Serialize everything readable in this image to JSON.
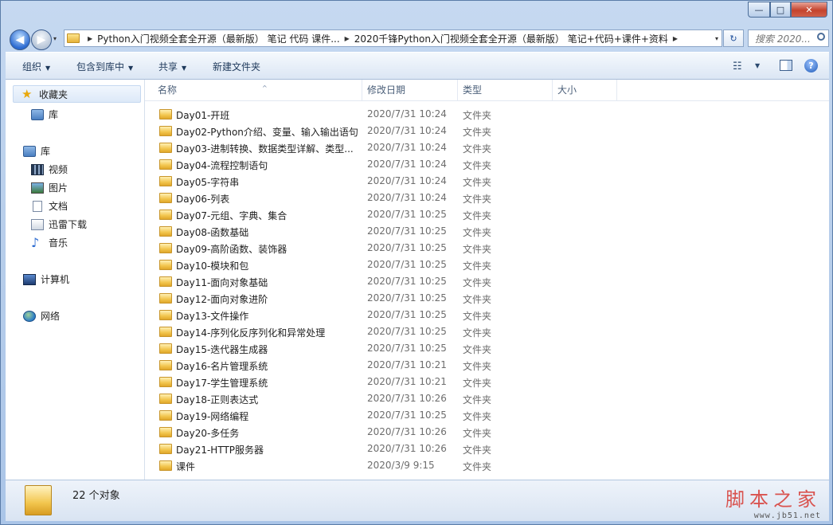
{
  "window": {
    "caption_buttons": {
      "minimize": "—",
      "maximize": "□",
      "close": "✕"
    }
  },
  "nav": {
    "back_icon": "◀",
    "forward_icon": "▶",
    "dropdown_icon": "▾"
  },
  "address": {
    "crumbs": [
      "Python入门视频全套全开源（最新版） 笔记 代码 课件...",
      "2020千锋Python入门视频全套全开源（最新版） 笔记+代码+课件+资料"
    ],
    "separator": "▶",
    "refresh_icon": "↻"
  },
  "search": {
    "placeholder": "搜索 2020..."
  },
  "toolbar": {
    "organize": "组织",
    "include_in_library": "包含到库中",
    "share": "共享",
    "new_folder": "新建文件夹",
    "dropdown_arrow": "▼",
    "view_icon": "☷",
    "help": "?"
  },
  "sidebar": {
    "favorites": "收藏夹",
    "favorites_child": "库",
    "libraries": "库",
    "lib_items": [
      "视频",
      "图片",
      "文档",
      "迅雷下载",
      "音乐"
    ],
    "computer": "计算机",
    "network": "网络"
  },
  "columns": {
    "name": "名称",
    "modified": "修改日期",
    "type": "类型",
    "size": "大小",
    "sort_arrow": "^"
  },
  "files": [
    {
      "name": "Day01-开班",
      "date": "2020/7/31 10:24",
      "type": "文件夹"
    },
    {
      "name": "Day02-Python介绍、变量、输入输出语句",
      "date": "2020/7/31 10:24",
      "type": "文件夹"
    },
    {
      "name": "Day03-进制转换、数据类型详解、类型...",
      "date": "2020/7/31 10:24",
      "type": "文件夹"
    },
    {
      "name": "Day04-流程控制语句",
      "date": "2020/7/31 10:24",
      "type": "文件夹"
    },
    {
      "name": "Day05-字符串",
      "date": "2020/7/31 10:24",
      "type": "文件夹"
    },
    {
      "name": "Day06-列表",
      "date": "2020/7/31 10:24",
      "type": "文件夹"
    },
    {
      "name": "Day07-元组、字典、集合",
      "date": "2020/7/31 10:25",
      "type": "文件夹"
    },
    {
      "name": "Day08-函数基础",
      "date": "2020/7/31 10:25",
      "type": "文件夹"
    },
    {
      "name": "Day09-高阶函数、装饰器",
      "date": "2020/7/31 10:25",
      "type": "文件夹"
    },
    {
      "name": "Day10-模块和包",
      "date": "2020/7/31 10:25",
      "type": "文件夹"
    },
    {
      "name": "Day11-面向对象基础",
      "date": "2020/7/31 10:25",
      "type": "文件夹"
    },
    {
      "name": "Day12-面向对象进阶",
      "date": "2020/7/31 10:25",
      "type": "文件夹"
    },
    {
      "name": "Day13-文件操作",
      "date": "2020/7/31 10:25",
      "type": "文件夹"
    },
    {
      "name": "Day14-序列化反序列化和异常处理",
      "date": "2020/7/31 10:25",
      "type": "文件夹"
    },
    {
      "name": "Day15-迭代器生成器",
      "date": "2020/7/31 10:25",
      "type": "文件夹"
    },
    {
      "name": "Day16-名片管理系统",
      "date": "2020/7/31 10:21",
      "type": "文件夹"
    },
    {
      "name": "Day17-学生管理系统",
      "date": "2020/7/31 10:21",
      "type": "文件夹"
    },
    {
      "name": "Day18-正则表达式",
      "date": "2020/7/31 10:26",
      "type": "文件夹"
    },
    {
      "name": "Day19-网络编程",
      "date": "2020/7/31 10:25",
      "type": "文件夹"
    },
    {
      "name": "Day20-多任务",
      "date": "2020/7/31 10:26",
      "type": "文件夹"
    },
    {
      "name": "Day21-HTTP服务器",
      "date": "2020/7/31 10:26",
      "type": "文件夹"
    },
    {
      "name": "课件",
      "date": "2020/3/9 9:15",
      "type": "文件夹"
    }
  ],
  "status": {
    "count": "22 个对象"
  },
  "watermark": {
    "title": "脚本之家",
    "url": "www.jb51.net"
  }
}
